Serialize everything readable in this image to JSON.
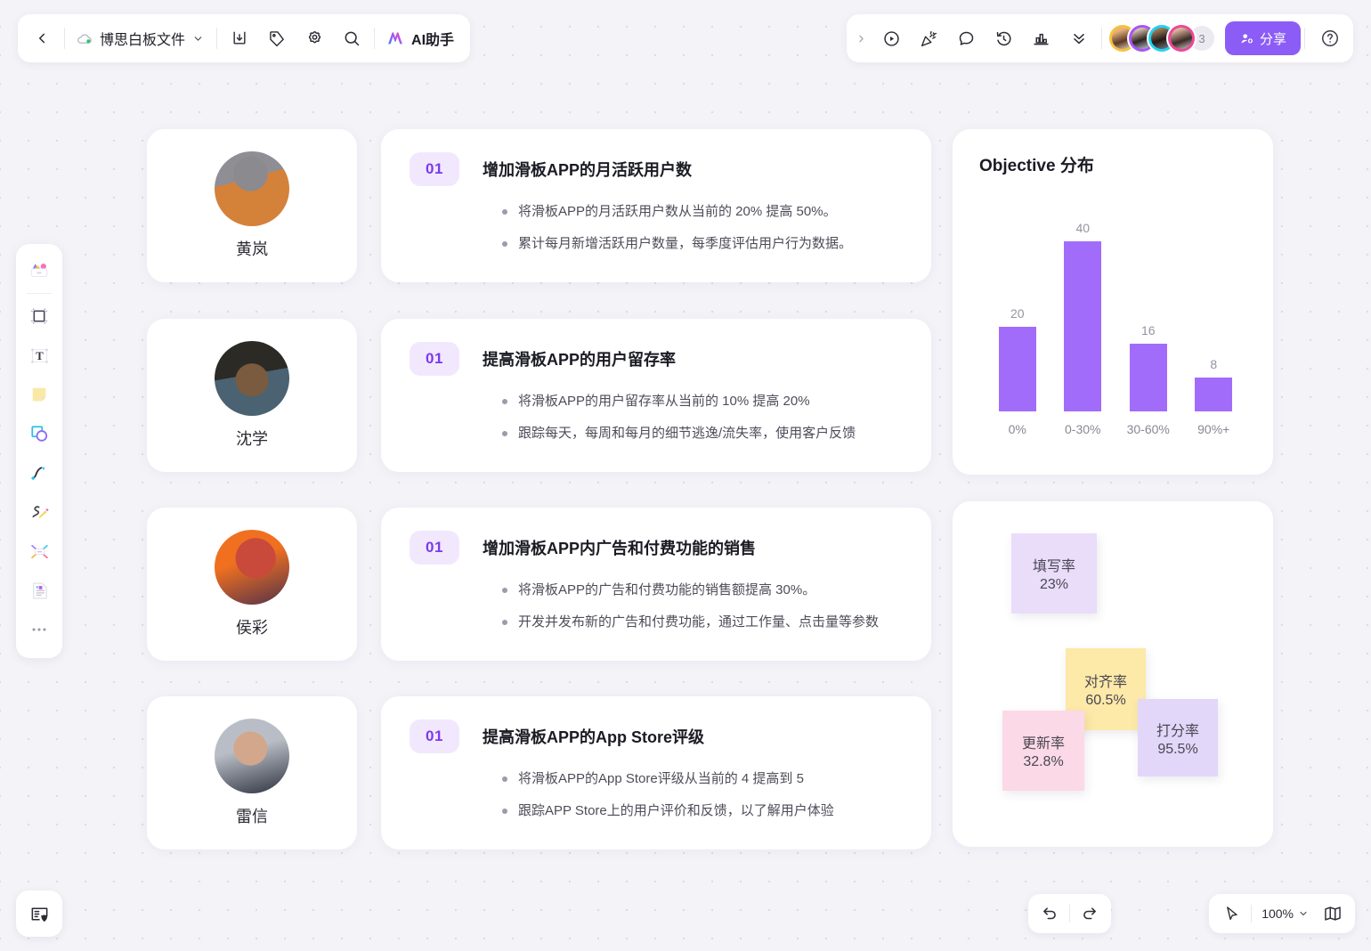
{
  "topbar": {
    "back_icon": "chevron-left-icon",
    "cloud_icon": "cloud-saved-icon",
    "doc_title": "博思白板文件",
    "doc_caret": "chevron-down-icon",
    "download_icon": "download-icon",
    "tag_icon": "tag-icon",
    "settings_icon": "gear-icon",
    "search_icon": "search-icon",
    "ai_icon": "ai-sparkle-icon",
    "ai_label": "AI助手",
    "expand_icon": "chevron-right-icon",
    "present_icon": "play-circle-icon",
    "celebrate_icon": "party-popper-icon",
    "comment_icon": "comment-bubble-icon",
    "timer_icon": "timer-icon",
    "chart_icon": "bar-chart-icon",
    "more_icon": "double-chevron-down-icon",
    "collaborators": [
      {
        "name": "collaborator-1",
        "ring": "#f5c23e"
      },
      {
        "name": "collaborator-2",
        "ring": "#a855f7"
      },
      {
        "name": "collaborator-3",
        "ring": "#22d3ee"
      },
      {
        "name": "collaborator-4",
        "ring": "#ec4899"
      }
    ],
    "collaborator_overflow": "3",
    "share_icon": "user-add-icon",
    "share_label": "分享",
    "help_icon": "question-circle-icon"
  },
  "left_toolbar": {
    "items": [
      {
        "name": "templates-icon",
        "label": "模板"
      },
      {
        "name": "frame-icon",
        "label": "画框"
      },
      {
        "name": "text-icon",
        "label": "文本"
      },
      {
        "name": "sticky-note-icon",
        "label": "便签"
      },
      {
        "name": "shapes-icon",
        "label": "形状"
      },
      {
        "name": "connector-icon",
        "label": "连线"
      },
      {
        "name": "pen-icon",
        "label": "画笔"
      },
      {
        "name": "mindmap-icon",
        "label": "思维导图"
      },
      {
        "name": "media-icon",
        "label": "素材"
      },
      {
        "name": "more-dots-icon",
        "label": "更多"
      }
    ]
  },
  "bottom": {
    "canvas_icon": "canvas-panel-icon",
    "undo_icon": "undo-icon",
    "redo_icon": "redo-icon",
    "cursor_icon": "cursor-arrow-icon",
    "zoom_level": "100%",
    "zoom_caret": "chevron-down-icon",
    "minimap_icon": "minimap-icon"
  },
  "objectives": [
    {
      "person": "黄岚",
      "badge": "01",
      "title": "增加滑板APP的月活跃用户数",
      "points": [
        "将滑板APP的月活跃用户数从当前的 20% 提高 50%。",
        "累计每月新增活跃用户数量，每季度评估用户行为数据。"
      ]
    },
    {
      "person": "沈学",
      "badge": "01",
      "title": "提高滑板APP的用户留存率",
      "points": [
        "将滑板APP的用户留存率从当前的 10% 提高 20%",
        "跟踪每天，每周和每月的细节逃逸/流失率，使用客户反馈"
      ]
    },
    {
      "person": "侯彩",
      "badge": "01",
      "title": "增加滑板APP内广告和付费功能的销售",
      "points": [
        "将滑板APP的广告和付费功能的销售额提高 30%。",
        "开发并发布新的广告和付费功能，通过工作量、点击量等参数"
      ]
    },
    {
      "person": "雷信",
      "badge": "01",
      "title": "提高滑板APP的App Store评级",
      "points": [
        "将滑板APP的App Store评级从当前的 4 提高到 5",
        "跟踪APP Store上的用户评价和反馈，以了解用户体验"
      ]
    }
  ],
  "chart_data": {
    "type": "bar",
    "title": "Objective 分布",
    "categories": [
      "0%",
      "0-30%",
      "30-60%",
      "90%+"
    ],
    "values": [
      20,
      40,
      16,
      8
    ],
    "xlabel": "",
    "ylabel": "",
    "ylim": [
      0,
      44
    ],
    "grid": false,
    "legend": "none",
    "bar_color": "#a26cfb",
    "data_labels": true
  },
  "sticky_notes": [
    {
      "name": "填写率",
      "value": "23%",
      "color": "#e9ddfa"
    },
    {
      "name": "对齐率",
      "value": "60.5%",
      "color": "#fde9a8"
    },
    {
      "name": "更新率",
      "value": "32.8%",
      "color": "#fcd9e6"
    },
    {
      "name": "打分率",
      "value": "95.5%",
      "color": "#e2d7f9"
    }
  ]
}
